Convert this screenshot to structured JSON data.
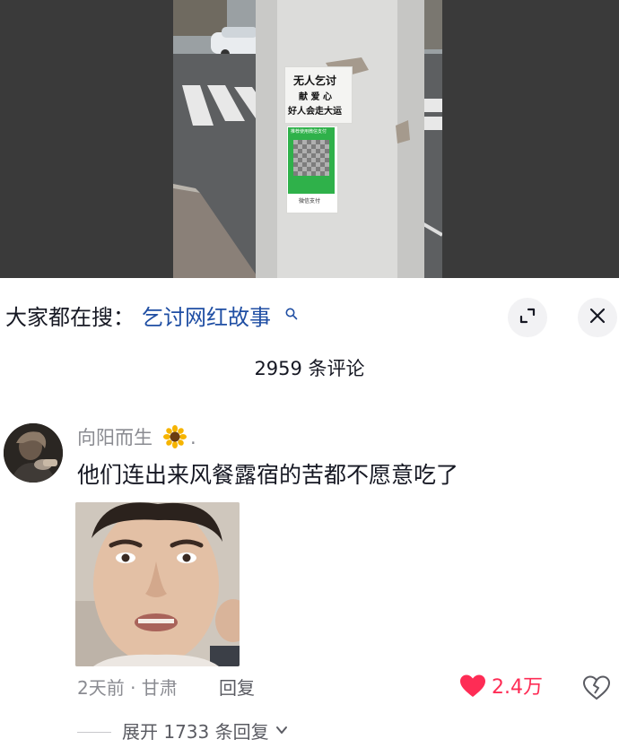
{
  "video": {
    "sign_line1": "无人乞讨",
    "sign_line2": "献 爱 心",
    "sign_line3": "好人会走大运",
    "qr_header": "推荐使用微信支付",
    "qr_footer": "微信支付"
  },
  "search": {
    "prefix": "大家都在搜：",
    "keyword": "乞讨网红故事"
  },
  "comments": {
    "count_label": "2959 条评论"
  },
  "comment": {
    "username": "向阳而生",
    "name_suffix": ".",
    "text": "他们连出来风餐露宿的苦都不愿意吃了",
    "time_location": "2天前 · 甘肃",
    "reply_label": "回复",
    "like_count": "2.4万",
    "expand_label": "展开 1733 条回复"
  },
  "colors": {
    "like_red": "#fe2c55",
    "link_blue": "#1f4ea3",
    "muted_gray": "#8a8b91"
  },
  "icons": {
    "search": "search-icon",
    "expand": "expand-icon",
    "close": "close-icon",
    "sunflower": "sunflower-icon",
    "heart": "heart-icon",
    "dislike": "broken-heart-icon",
    "chevron": "chevron-down-icon"
  }
}
